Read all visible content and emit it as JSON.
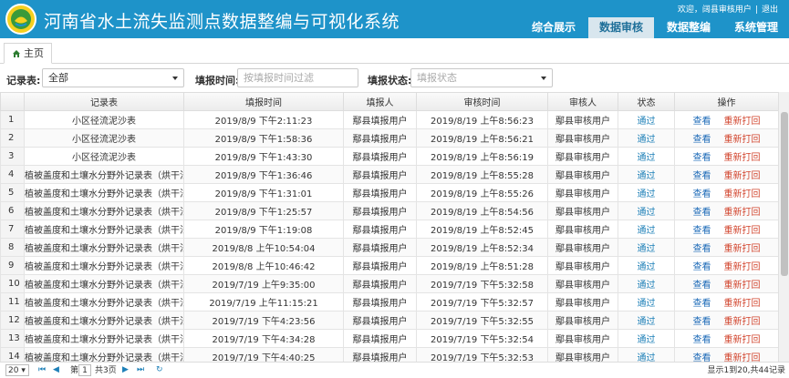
{
  "app": {
    "title": "河南省水土流失监测点数据整编与可视化系统",
    "user_greeting": "欢迎，阔县审核用户",
    "exit_label": "退出",
    "nav": [
      {
        "label": "综合展示",
        "active": false
      },
      {
        "label": "数据审核",
        "active": true
      },
      {
        "label": "数据整编",
        "active": false
      },
      {
        "label": "系统管理",
        "active": false
      }
    ]
  },
  "tabs": {
    "home": "主页"
  },
  "filters": {
    "table_label": "记录表:",
    "table_value": "全部",
    "time_label": "填报时间:",
    "time_placeholder": "按填报时间过滤",
    "status_label": "填报状态:",
    "status_placeholder": "填报状态"
  },
  "table": {
    "columns": [
      "记录表",
      "填报时间",
      "填报人",
      "审核时间",
      "审核人",
      "状态",
      "操作"
    ],
    "action_view": "查看",
    "action_reprint": "重新打回",
    "rows": [
      {
        "n": "1",
        "record": "小区径流泥沙表",
        "fill_time": "2019/8/9 下午2:11:23",
        "filler": "鄢县填报用户",
        "review_time": "2019/8/19 上午8:56:23",
        "reviewer": "鄢县审核用户",
        "status": "通过"
      },
      {
        "n": "2",
        "record": "小区径流泥沙表",
        "fill_time": "2019/8/9 下午1:58:36",
        "filler": "鄢县填报用户",
        "review_time": "2019/8/19 上午8:56:21",
        "reviewer": "鄢县审核用户",
        "status": "通过"
      },
      {
        "n": "3",
        "record": "小区径流泥沙表",
        "fill_time": "2019/8/9 下午1:43:30",
        "filler": "鄢县填报用户",
        "review_time": "2019/8/19 上午8:56:19",
        "reviewer": "鄢县审核用户",
        "status": "通过"
      },
      {
        "n": "4",
        "record": "植被盖度和土壤水分野外记录表（烘干法）",
        "fill_time": "2019/8/9 下午1:36:46",
        "filler": "鄢县填报用户",
        "review_time": "2019/8/19 上午8:55:28",
        "reviewer": "鄢县审核用户",
        "status": "通过"
      },
      {
        "n": "5",
        "record": "植被盖度和土壤水分野外记录表（烘干法）",
        "fill_time": "2019/8/9 下午1:31:01",
        "filler": "鄢县填报用户",
        "review_time": "2019/8/19 上午8:55:26",
        "reviewer": "鄢县审核用户",
        "status": "通过"
      },
      {
        "n": "6",
        "record": "植被盖度和土壤水分野外记录表（烘干法）",
        "fill_time": "2019/8/9 下午1:25:57",
        "filler": "鄢县填报用户",
        "review_time": "2019/8/19 上午8:54:56",
        "reviewer": "鄢县审核用户",
        "status": "通过"
      },
      {
        "n": "7",
        "record": "植被盖度和土壤水分野外记录表（烘干法）",
        "fill_time": "2019/8/9 下午1:19:08",
        "filler": "鄢县填报用户",
        "review_time": "2019/8/19 上午8:52:45",
        "reviewer": "鄢县审核用户",
        "status": "通过"
      },
      {
        "n": "8",
        "record": "植被盖度和土壤水分野外记录表（烘干法）",
        "fill_time": "2019/8/8 上午10:54:04",
        "filler": "鄢县填报用户",
        "review_time": "2019/8/19 上午8:52:34",
        "reviewer": "鄢县审核用户",
        "status": "通过"
      },
      {
        "n": "9",
        "record": "植被盖度和土壤水分野外记录表（烘干法）",
        "fill_time": "2019/8/8 上午10:46:42",
        "filler": "鄢县填报用户",
        "review_time": "2019/8/19 上午8:51:28",
        "reviewer": "鄢县审核用户",
        "status": "通过"
      },
      {
        "n": "10",
        "record": "植被盖度和土壤水分野外记录表（烘干法）",
        "fill_time": "2019/7/19 上午9:35:00",
        "filler": "鄢县填报用户",
        "review_time": "2019/7/19 下午5:32:58",
        "reviewer": "鄢县审核用户",
        "status": "通过"
      },
      {
        "n": "11",
        "record": "植被盖度和土壤水分野外记录表（烘干法）",
        "fill_time": "2019/7/19 上午11:15:21",
        "filler": "鄢县填报用户",
        "review_time": "2019/7/19 下午5:32:57",
        "reviewer": "鄢县审核用户",
        "status": "通过"
      },
      {
        "n": "12",
        "record": "植被盖度和土壤水分野外记录表（烘干法）",
        "fill_time": "2019/7/19 下午4:23:56",
        "filler": "鄢县填报用户",
        "review_time": "2019/7/19 下午5:32:55",
        "reviewer": "鄢县审核用户",
        "status": "通过"
      },
      {
        "n": "13",
        "record": "植被盖度和土壤水分野外记录表（烘干法）",
        "fill_time": "2019/7/19 下午4:34:28",
        "filler": "鄢县填报用户",
        "review_time": "2019/7/19 下午5:32:54",
        "reviewer": "鄢县审核用户",
        "status": "通过"
      },
      {
        "n": "14",
        "record": "植被盖度和土壤水分野外记录表（烘干法）",
        "fill_time": "2019/7/19 下午4:40:25",
        "filler": "鄢县填报用户",
        "review_time": "2019/7/19 下午5:32:53",
        "reviewer": "鄢县审核用户",
        "status": "通过"
      }
    ]
  },
  "pager": {
    "page_size": "20",
    "page_prefix": "第",
    "page_current": "1",
    "page_total": "共3页",
    "summary": "显示1到20,共44记录"
  }
}
